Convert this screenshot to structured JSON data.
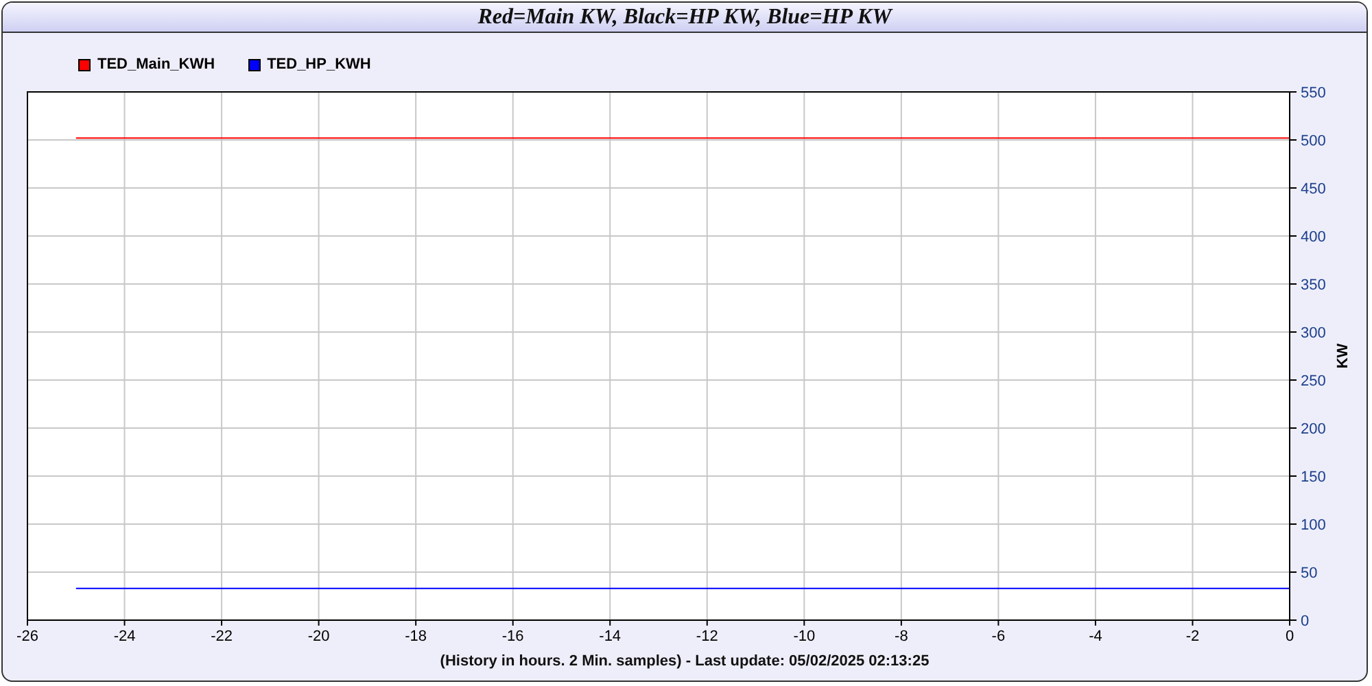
{
  "title": "Red=Main KW, Black=HP KW, Blue=HP KW",
  "chart_data": {
    "type": "line",
    "xlabel": "(History in hours. 2 Min. samples) - Last update: 05/02/2025 02:13:25",
    "ylabel": "KW",
    "x": [
      -25,
      0
    ],
    "series": [
      {
        "name": "TED_Main_KWH",
        "color": "#ff0000",
        "values": [
          502,
          502
        ]
      },
      {
        "name": "TED_HP_KWH",
        "color": "#0000ff",
        "values": [
          33,
          33
        ]
      }
    ],
    "grid": true,
    "xlim": [
      -26,
      0
    ],
    "ylim": [
      0,
      550
    ],
    "xticks": [
      -26,
      -24,
      -22,
      -20,
      -18,
      -16,
      -14,
      -12,
      -10,
      -8,
      -6,
      -4,
      -2,
      0
    ],
    "yticks": [
      0,
      50,
      100,
      150,
      200,
      250,
      300,
      350,
      400,
      450,
      500,
      550
    ]
  }
}
